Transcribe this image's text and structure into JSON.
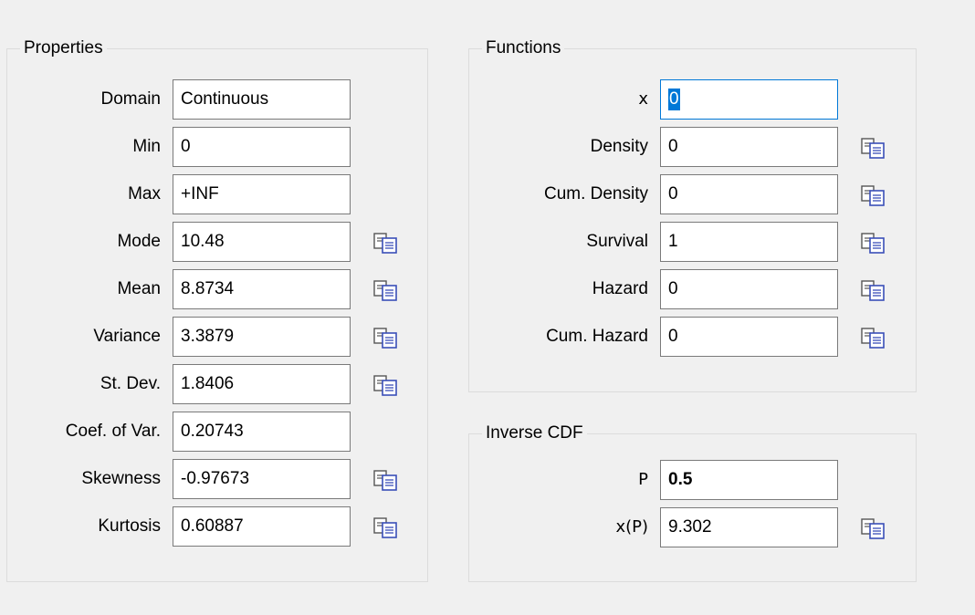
{
  "properties": {
    "title": "Properties",
    "rows": [
      {
        "label": "Domain",
        "value": "Continuous",
        "copy": false
      },
      {
        "label": "Min",
        "value": "0",
        "copy": false
      },
      {
        "label": "Max",
        "value": "+INF",
        "copy": false
      },
      {
        "label": "Mode",
        "value": "10.48",
        "copy": true
      },
      {
        "label": "Mean",
        "value": "8.8734",
        "copy": true
      },
      {
        "label": "Variance",
        "value": "3.3879",
        "copy": true
      },
      {
        "label": "St. Dev.",
        "value": "1.8406",
        "copy": true
      },
      {
        "label": "Coef. of Var.",
        "value": "0.20743",
        "copy": false
      },
      {
        "label": "Skewness",
        "value": "-0.97673",
        "copy": true
      },
      {
        "label": "Kurtosis",
        "value": "0.60887",
        "copy": true
      }
    ]
  },
  "functions": {
    "title": "Functions",
    "x": {
      "label": "x",
      "value": "0"
    },
    "rows": [
      {
        "label": "Density",
        "value": "0"
      },
      {
        "label": "Cum. Density",
        "value": "0"
      },
      {
        "label": "Survival",
        "value": "1"
      },
      {
        "label": "Hazard",
        "value": "0"
      },
      {
        "label": "Cum. Hazard",
        "value": "0"
      }
    ]
  },
  "inverse_cdf": {
    "title": "Inverse CDF",
    "p": {
      "label": "P",
      "value": "0.5"
    },
    "xp": {
      "label": "x(P)",
      "value": "9.302"
    }
  },
  "icons": {
    "copy": "copy-icon"
  },
  "colors": {
    "focus_border": "#0078d7",
    "selection": "#0078d7",
    "icon_blue": "#3a4fb8"
  }
}
